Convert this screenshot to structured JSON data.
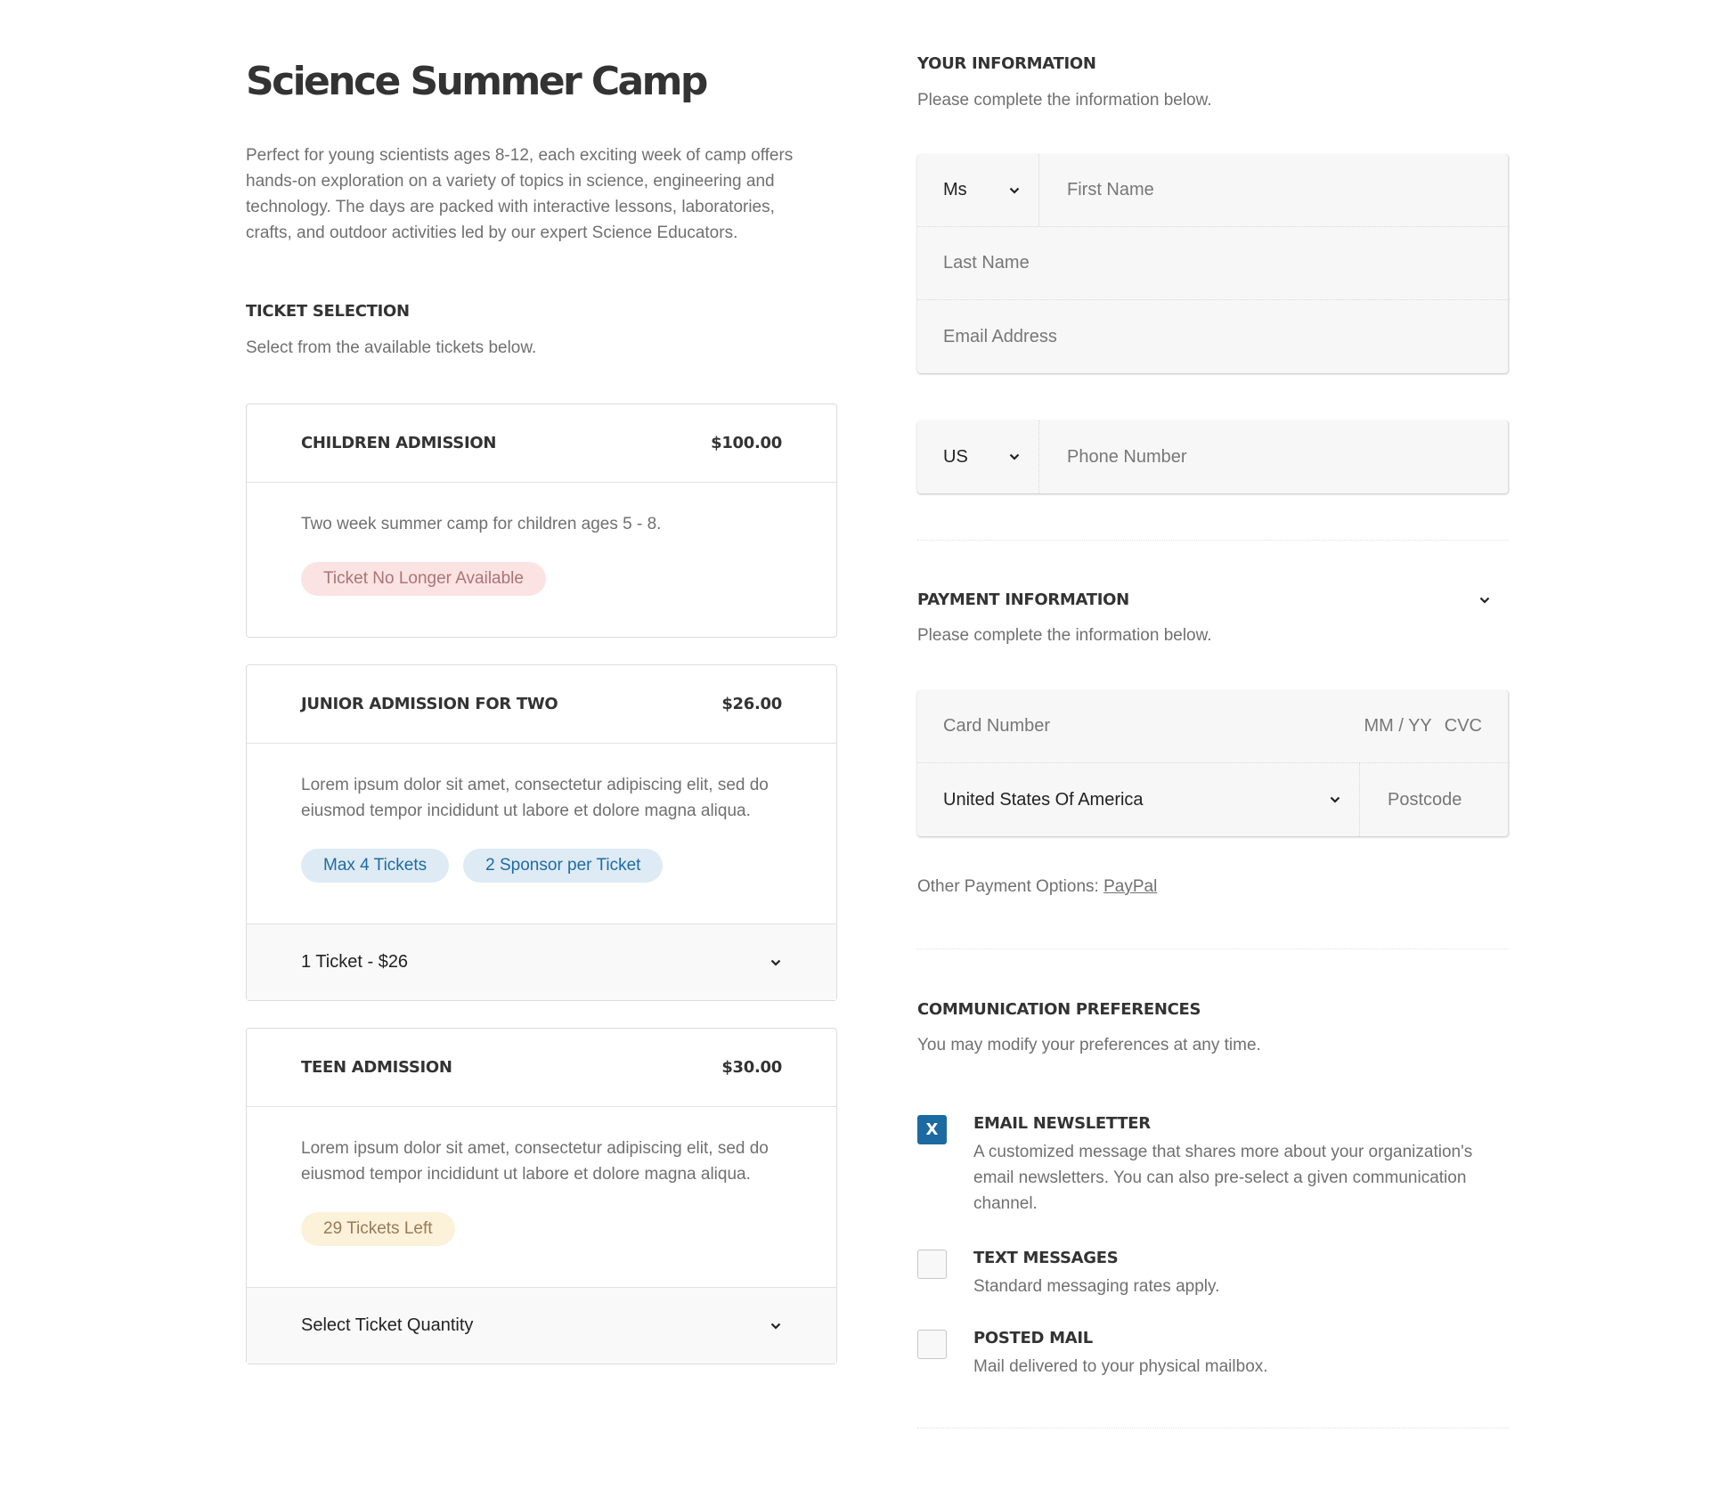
{
  "event": {
    "title": "Science Summer Camp",
    "description": "Perfect for young scientists ages 8-12, each exciting week of camp offers hands-on exploration on a variety of topics in science, engineering and technology. The days are packed with interactive lessons, laboratories, crafts, and outdoor activities led by our expert Science Educators."
  },
  "ticket_selection": {
    "heading": "TICKET SELECTION",
    "subheading": "Select from the available tickets below.",
    "tickets": [
      {
        "name": "CHILDREN ADMISSION",
        "price": "$100.00",
        "description": "Two week summer camp for children ages 5 - 8.",
        "badges": [
          {
            "label": "Ticket No Longer Available",
            "type": "unavailable"
          }
        ]
      },
      {
        "name": "JUNIOR ADMISSION FOR TWO",
        "price": "$26.00",
        "description": "Lorem ipsum dolor sit amet, consectetur adipiscing elit, sed do eiusmod tempor incididunt ut labore et dolore magna aliqua.",
        "badges": [
          {
            "label": "Max 4 Tickets",
            "type": "info"
          },
          {
            "label": "2 Sponsor per Ticket",
            "type": "info"
          }
        ],
        "quantity_select": "1 Ticket - $26"
      },
      {
        "name": "TEEN ADMISSION",
        "price": "$30.00",
        "description": "Lorem ipsum dolor sit amet, consectetur adipiscing elit, sed do eiusmod tempor incididunt ut labore et dolore magna aliqua.",
        "badges": [
          {
            "label": "29 Tickets Left",
            "type": "warning"
          }
        ],
        "quantity_select": "Select Ticket Quantity"
      }
    ]
  },
  "your_information": {
    "heading": "YOUR INFORMATION",
    "subheading": "Please complete the information below.",
    "salutation": "Ms",
    "first_name_placeholder": "First Name",
    "last_name_placeholder": "Last Name",
    "email_placeholder": "Email Address",
    "phone_country": "US",
    "phone_placeholder": "Phone Number"
  },
  "payment_information": {
    "heading": "PAYMENT INFORMATION",
    "subheading": "Please complete the information below.",
    "card_number_placeholder": "Card Number",
    "expiry_placeholder": "MM / YY",
    "cvc_placeholder": "CVC",
    "country": "United States Of America",
    "postcode_placeholder": "Postcode",
    "other_options_label": "Other Payment Options:",
    "other_options_link": "PayPal"
  },
  "communication_preferences": {
    "heading": "COMMUNICATION PREFERENCES",
    "subheading": "You may modify your preferences at any time.",
    "options": [
      {
        "title": "EMAIL NEWSLETTER",
        "description": "A customized message that shares more about your organization's email newsletters. You can also pre-select a given communication channel.",
        "checked": true,
        "check_mark": "X"
      },
      {
        "title": "TEXT MESSAGES",
        "description": "Standard messaging rates apply.",
        "checked": false
      },
      {
        "title": "POSTED MAIL",
        "description": "Mail delivered to your physical mailbox.",
        "checked": false
      }
    ]
  },
  "colors": {
    "accent": "#1d6aa3",
    "badge_unavailable_bg": "#fbe3e3",
    "badge_unavailable_text": "#ab7477",
    "badge_info_bg": "#deebf4",
    "badge_info_text": "#1e6ba3",
    "badge_warning_bg": "#fcf1d9",
    "badge_warning_text": "#9a7a58"
  }
}
